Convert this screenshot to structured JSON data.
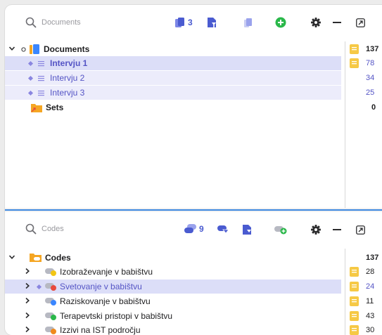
{
  "documents_panel": {
    "search_placeholder": "Documents",
    "doc_count": "3",
    "tree": {
      "root_label": "Documents",
      "root_count": "137",
      "items": [
        {
          "label": "Intervju 1",
          "count": "78"
        },
        {
          "label": "Intervju 2",
          "count": "34"
        },
        {
          "label": "Intervju 3",
          "count": "25"
        }
      ],
      "sets_label": "Sets",
      "sets_count": "0"
    }
  },
  "codes_panel": {
    "search_placeholder": "Codes",
    "code_count": "9",
    "tree": {
      "root_label": "Codes",
      "root_count": "137",
      "items": [
        {
          "label": "Izobraževanje v babištvu",
          "count": "28",
          "dot_color": "#f2c614"
        },
        {
          "label": "Svetovanje v babištvu",
          "count": "24",
          "dot_color": "#e8493c"
        },
        {
          "label": "Raziskovanje v babištvu",
          "count": "11",
          "dot_color": "#3a86ff"
        },
        {
          "label": "Terapevtski pristopi v babištvu",
          "count": "43",
          "dot_color": "#2ab84a"
        },
        {
          "label": "Izzivi na IST področju",
          "count": "30",
          "dot_color": "#f08a1c"
        }
      ]
    }
  },
  "colors": {
    "accent": "#4a5bd0",
    "selection": "#dcdef8",
    "memo_yellow": "#f6c945",
    "folder_orange": "#f5a623",
    "add_green": "#2ab84a"
  }
}
